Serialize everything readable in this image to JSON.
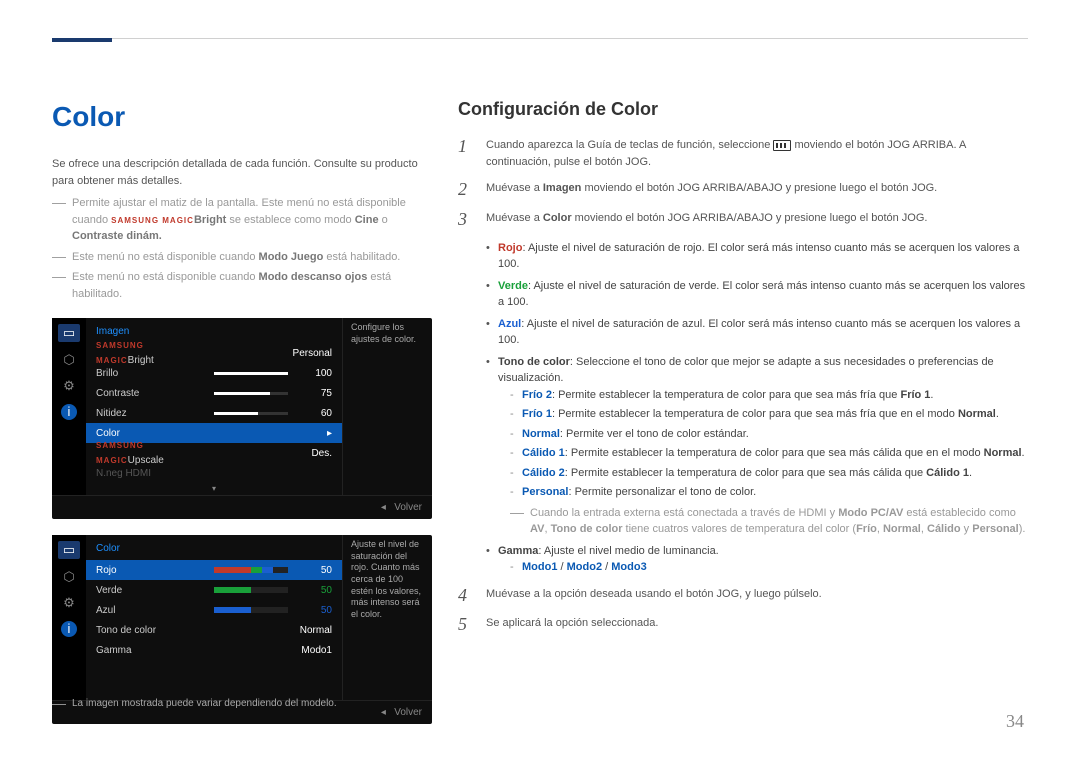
{
  "page_number": "34",
  "left": {
    "title": "Color",
    "intro": "Se ofrece una descripción detallada de cada función. Consulte su producto para obtener más detalles.",
    "note1_pre": "Permite ajustar el matiz de la pantalla. Este menú no está disponible cuando ",
    "note1_brand": "SAMSUNG MAGIC",
    "note1_bright": "Bright",
    "note1_mid": " se establece como modo ",
    "note1_cine": "Cine",
    "note1_o": " o ",
    "note1_contraste": "Contraste dinám.",
    "note2_pre": "Este menú no está disponible cuando ",
    "note2_bold": "Modo Juego",
    "note2_post": " está habilitado.",
    "note3_pre": "Este menú no está disponible cuando ",
    "note3_bold": "Modo descanso ojos",
    "note3_post": " está habilitado.",
    "footnote": "La imagen mostrada puede variar dependiendo del modelo."
  },
  "osd1": {
    "title": "Imagen",
    "side_desc": "Configure los ajustes de color.",
    "rows": {
      "bright": "Bright",
      "bright_val": "Personal",
      "brillo": "Brillo",
      "brillo_val": "100",
      "contraste": "Contraste",
      "contraste_val": "75",
      "nitidez": "Nitidez",
      "nitidez_val": "60",
      "color": "Color",
      "upscale": "Upscale",
      "upscale_val": "Des.",
      "nneg": "N.neg HDMI"
    },
    "volver": "Volver"
  },
  "osd2": {
    "title": "Color",
    "side_desc": "Ajuste el nivel de saturación del rojo. Cuanto más cerca de 100 estén los valores, más intenso será el color.",
    "rows": {
      "rojo": "Rojo",
      "rojo_val": "50",
      "verde": "Verde",
      "verde_val": "50",
      "azul": "Azul",
      "azul_val": "50",
      "tono": "Tono de color",
      "tono_val": "Normal",
      "gamma": "Gamma",
      "gamma_val": "Modo1"
    },
    "volver": "Volver"
  },
  "right": {
    "title": "Configuración de Color",
    "step1_pre": "Cuando aparezca la Guía de teclas de función, seleccione ",
    "step1_post": " moviendo el botón JOG ARRIBA. A continuación, pulse el botón JOG.",
    "step2_pre": "Muévase a ",
    "step2_bold": "Imagen",
    "step2_post": " moviendo el botón JOG ARRIBA/ABAJO y presione luego el botón JOG.",
    "step3_pre": "Muévase a ",
    "step3_bold": "Color",
    "step3_post": " moviendo el botón JOG ARRIBA/ABAJO y presione luego el botón JOG.",
    "bullets": {
      "rojo_label": "Rojo",
      "rojo_text": ": Ajuste el nivel de saturación de rojo. El color será más intenso cuanto más se acerquen los valores a 100.",
      "verde_label": "Verde",
      "verde_text": ": Ajuste el nivel de saturación de verde. El color será más intenso cuanto más se acerquen los valores a 100.",
      "azul_label": "Azul",
      "azul_text": ": Ajuste el nivel de saturación de azul. El color será más intenso cuanto más se acerquen los valores a 100.",
      "tono_label": "Tono de color",
      "tono_text": ": Seleccione el tono de color que mejor se adapte a sus necesidades o preferencias de visualización.",
      "frio2_label": "Frío 2",
      "frio2_text": ": Permite establecer la temperatura de color para que sea más fría que ",
      "frio2_ref": "Frío 1",
      "frio1_label": "Frío 1",
      "frio1_text": ": Permite establecer la temperatura de color para que sea más fría que en el modo ",
      "frio1_ref": "Normal",
      "normal_label": "Normal",
      "normal_text": ": Permite ver el tono de color estándar.",
      "calido1_label": "Cálido 1",
      "calido1_text": ": Permite establecer la temperatura de color para que sea más cálida que en el modo ",
      "calido1_ref": "Normal",
      "calido2_label": "Cálido 2",
      "calido2_text": ": Permite establecer la temperatura de color para que sea más cálida que ",
      "calido2_ref": "Cálido 1",
      "personal_label": "Personal",
      "personal_text": ": Permite personalizar el tono de color.",
      "note_pre": "Cuando la entrada externa está conectada a través de HDMI y ",
      "note_b1": "Modo PC/AV",
      "note_mid1": " está establecido como ",
      "note_b2": "AV",
      "note_mid2": ", ",
      "note_b3": "Tono de color",
      "note_mid3": " tiene cuatros valores de temperatura del color (",
      "note_v1": "Frío",
      "note_c1": ", ",
      "note_v2": "Normal",
      "note_c2": ", ",
      "note_v3": "Cálido",
      "note_c3": " y ",
      "note_v4": "Personal",
      "note_end": ").",
      "gamma_label": "Gamma",
      "gamma_text": ": Ajuste el nivel medio de luminancia.",
      "modo1": "Modo1",
      "sep": " / ",
      "modo2": "Modo2",
      "modo3": "Modo3"
    },
    "step4": "Muévase a la opción deseada usando el botón JOG, y luego púlselo.",
    "step5": "Se aplicará la opción seleccionada."
  }
}
